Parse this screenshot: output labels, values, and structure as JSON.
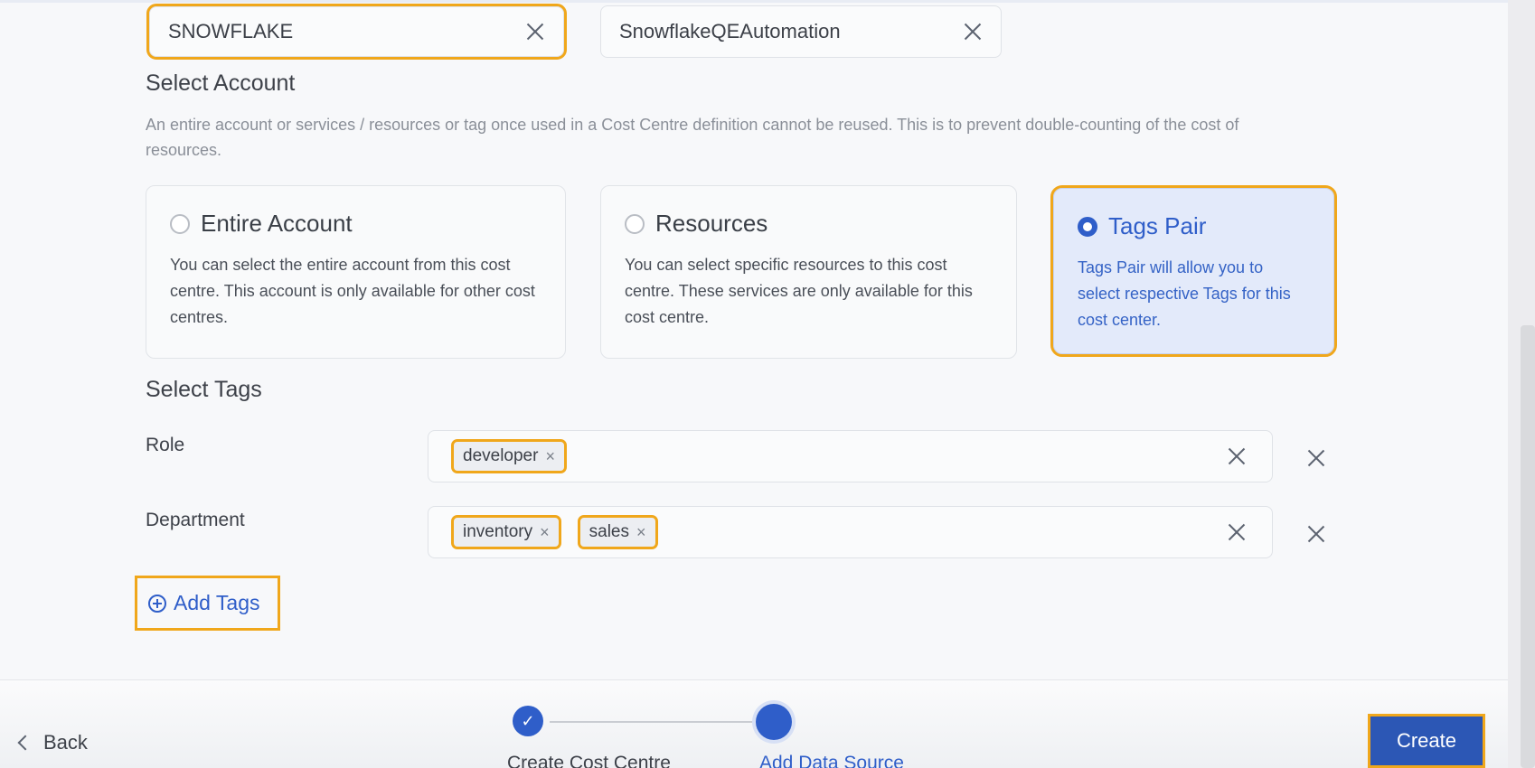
{
  "connection": {
    "type_value": "SNOWFLAKE",
    "name_value": "SnowflakeQEAutomation"
  },
  "select_account": {
    "title": "Select Account",
    "description": "An entire account or services / resources or tag once used in a Cost Centre definition cannot be reused. This is to prevent double-counting of the cost of resources.",
    "options": [
      {
        "title": "Entire Account",
        "body": "You can select the entire account from this cost centre. This account is only available for other cost centres.",
        "selected": false
      },
      {
        "title": "Resources",
        "body": "You can select specific resources to this cost centre. These services are only available for this cost centre.",
        "selected": false
      },
      {
        "title": "Tags Pair",
        "body": "Tags Pair will allow you to select respective Tags for this cost center.",
        "selected": true
      }
    ]
  },
  "select_tags": {
    "title": "Select Tags",
    "rows": [
      {
        "label": "Role",
        "values": [
          "developer"
        ]
      },
      {
        "label": "Department",
        "values": [
          "inventory",
          "sales"
        ]
      }
    ],
    "add_label": "Add Tags"
  },
  "footer": {
    "back_label": "Back",
    "steps": [
      {
        "label": "Create Cost Centre",
        "state": "completed"
      },
      {
        "label": "Add Data Source",
        "state": "current"
      }
    ],
    "create_label": "Create"
  },
  "colors": {
    "accent": "#2f5ec9",
    "highlight": "#f0a71b",
    "selected_card_bg": "#e3eafa"
  }
}
